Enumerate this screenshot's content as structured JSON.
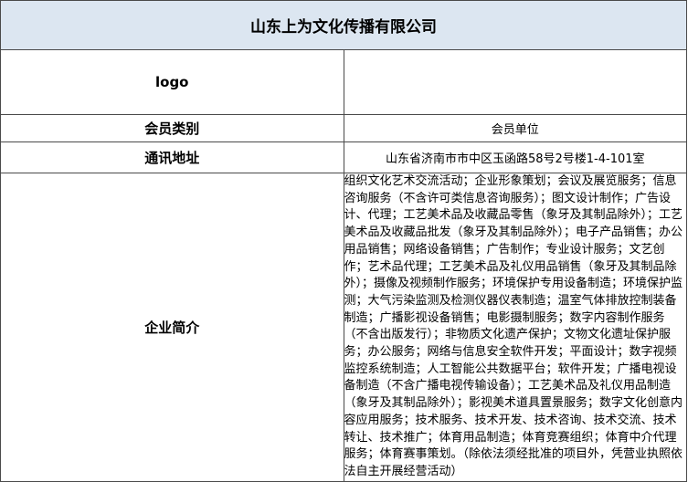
{
  "company": {
    "name": "山东上为文化传播有限公司"
  },
  "rows": {
    "logo": {
      "label": "logo",
      "value": ""
    },
    "member_type": {
      "label": "会员类别",
      "value": "会员单位"
    },
    "address": {
      "label": "通讯地址",
      "value": "山东省济南市市中区玉函路58号2号楼1-4-101室"
    },
    "intro": {
      "label": "企业简介",
      "value": "组织文化艺术交流活动；企业形象策划；会议及展览服务；信息咨询服务（不含许可类信息咨询服务）；图文设计制作；广告设计、代理；工艺美术品及收藏品零售（象牙及其制品除外）；工艺美术品及收藏品批发（象牙及其制品除外）；电子产品销售；办公用品销售；网络设备销售；广告制作；专业设计服务；文艺创作；艺术品代理；工艺美术品及礼仪用品销售（象牙及其制品除外）；摄像及视频制作服务；环境保护专用设备制造；环境保护监测；大气污染监测及检测仪器仪表制造；温室气体排放控制装备制造；广播影视设备销售；电影摄制服务；数字内容制作服务（不含出版发行）；非物质文化遗产保护；文物文化遗址保护服务；办公服务；网络与信息安全软件开发；平面设计；数字视频监控系统制造；人工智能公共数据平台；软件开发；广播电视设备制造（不含广播电视传输设备）；工艺美术品及礼仪用品制造（象牙及其制品除外）；影视美术道具置景服务；数字文化创意内容应用服务；技术服务、技术开发、技术咨询、技术交流、技术转让、技术推广；体育用品制造；体育竞赛组织；体育中介代理服务；体育赛事策划。（除依法须经批准的项目外，凭营业执照依法自主开展经营活动）"
    }
  }
}
